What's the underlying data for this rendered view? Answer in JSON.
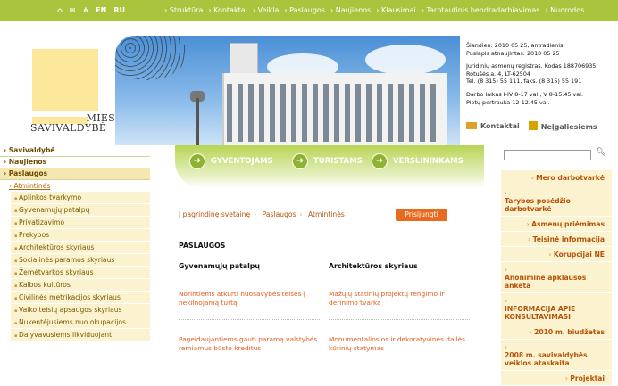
{
  "topbar": {
    "icons": [
      "home-icon",
      "mail-icon",
      "sitemap-icon"
    ],
    "languages": [
      "EN",
      "RU"
    ],
    "nav": [
      "Struktūra",
      "Kontaktai",
      "Veikla",
      "Paslaugos",
      "Naujienos",
      "Klausimai",
      "Tarptautinis bendradarbiavimas",
      "Nuorodos"
    ]
  },
  "logo": {
    "line1": "MIESTO",
    "line2": "SAVIVALDYBĖ"
  },
  "info": {
    "date": "Šiandien: 2010 05 25, antradienis",
    "updated": "Puslapis atnaujintas: 2010 05 25",
    "registry": "Juridinių asmenų registras. Kodas 188706935",
    "address": "Rotušės a. 4, LT-62504",
    "phone": "Tel. (8 315) 55 111, faks. (8 315) 55 191",
    "hours": "Darbo laikas I-IV 8-17 val., V 8-15.45 val.",
    "lunch": "Pietų pertrauka 12-12.45 val.",
    "contacts": "Kontaktai",
    "disabled": "Neįgaliesiems"
  },
  "audience": [
    "GYVENTOJAMS",
    "TURISTAMS",
    "VERSLININKAMS"
  ],
  "leftmenu": {
    "top": [
      "Savivaldybė",
      "Naujienos",
      "Paslaugos"
    ],
    "sub": "Atmintinės",
    "items": [
      "Aplinkos tvarkymo",
      "Gyvenamųjų patalpų",
      "Privatizavimo",
      "Prekybos",
      "Architektūros skyriaus",
      "Socialinės paramos skyriaus",
      "Žemėtvarkos skyriaus",
      "Kalbos kultūros",
      "Civilinės metrikacijos skyriaus",
      "Vaiko teisių apsaugos skyriaus",
      "Nukentėjusiems nuo okupacijos",
      "Dalyvavusiems likviduojant"
    ]
  },
  "breadcrumb": [
    "Į pagrindinę svetainę",
    "Paslaugos",
    "Atmintinės"
  ],
  "login": "Prisijungti",
  "section_title": "PASLAUGOS",
  "columns": [
    {
      "head": "Gyvenamųjų patalpų",
      "links": [
        "Norintiems atkurti nuosavybės teises į nekilnojamą turtą",
        "Pageidaujantiems gauti paramą valstybės remiamus būsto kreditus"
      ]
    },
    {
      "head": "Architektūros skyriaus",
      "links": [
        "Mažųjų statinių projektų rengimo ir derinimo tvarka",
        "Monumentaliosios ir dekoratyvinės dailės kūrinių statymas"
      ]
    }
  ],
  "rightmenu": [
    {
      "label": "Mero darbotvarkė",
      "style": "center"
    },
    {
      "label": "Tarybos posėdžio darbotvarkė",
      "style": "pre"
    },
    {
      "label": "Asmenų priėmimas",
      "style": "center"
    },
    {
      "label": "Teisinė informacija",
      "style": "center"
    },
    {
      "label": "Korupcijai NE",
      "style": "center"
    },
    {
      "label": "Anoniminė apklausos anketa",
      "style": "pre"
    },
    {
      "label": "INFORMACIJA APIE KONSULTAVIMASI",
      "style": "pre"
    },
    {
      "label": "2010 m. biudžetas",
      "style": "center"
    },
    {
      "label": "2008 m. savivaldybės veiklos ataskaita",
      "style": "pre"
    },
    {
      "label": "Projektai",
      "style": "center"
    }
  ]
}
